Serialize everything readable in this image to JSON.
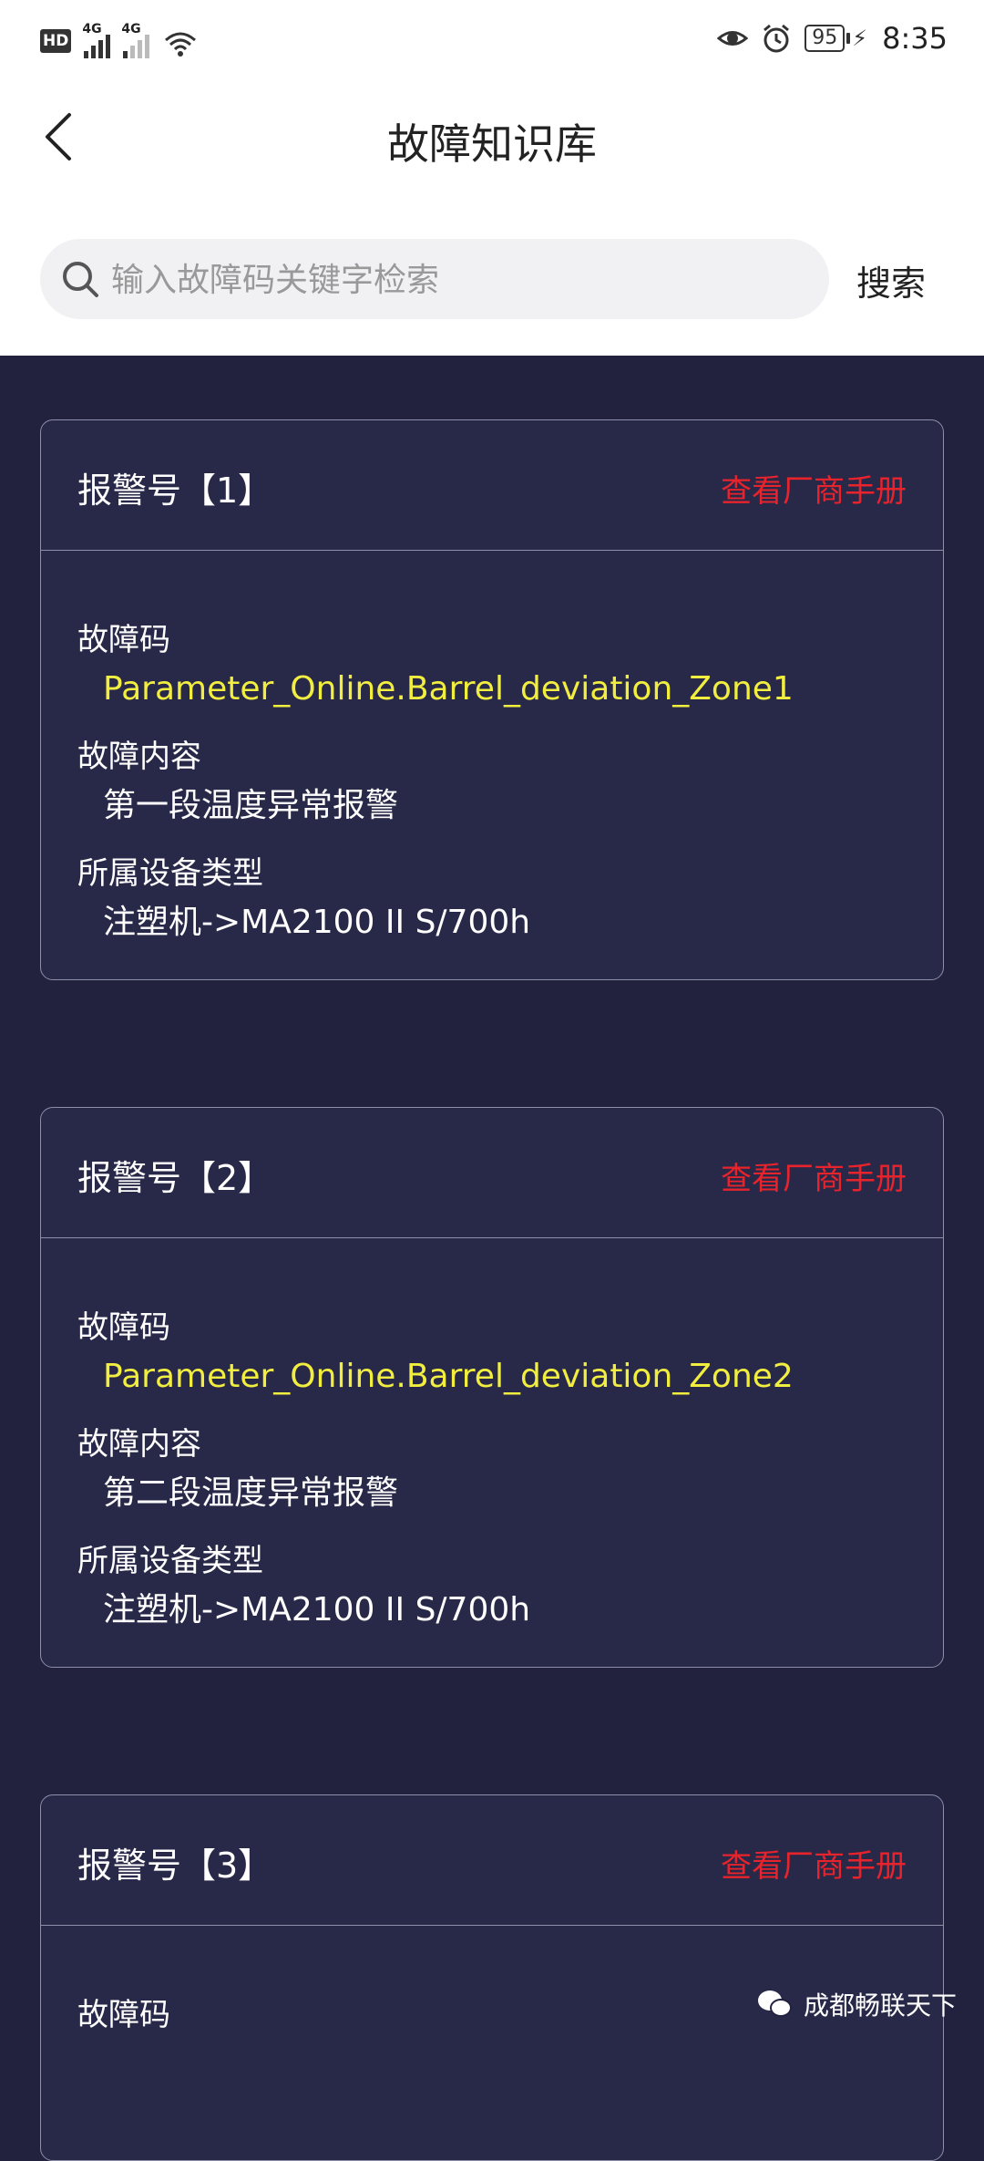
{
  "status_bar": {
    "hd": "HD",
    "signal1": "4G",
    "signal2": "4G",
    "battery": "95",
    "time": "8:35"
  },
  "header": {
    "title": "故障知识库",
    "back_icon": "chevron-left-icon"
  },
  "search": {
    "placeholder": "输入故障码关键字检索",
    "button": "搜索"
  },
  "labels": {
    "code": "故障码",
    "content": "故障内容",
    "device": "所属设备类型",
    "manual": "查看厂商手册"
  },
  "cards": [
    {
      "title": "报警号【1】",
      "code": "Parameter_Online.Barrel_deviation_Zone1",
      "content": "第一段温度异常报警",
      "device": "注塑机->MA2100 II S/700h"
    },
    {
      "title": "报警号【2】",
      "code": "Parameter_Online.Barrel_deviation_Zone2",
      "content": "第二段温度异常报警",
      "device": "注塑机->MA2100 II S/700h"
    },
    {
      "title": "报警号【3】",
      "code": "",
      "content": "",
      "device": ""
    }
  ],
  "watermark": "成都畅联天下",
  "colors": {
    "background": "#22223f",
    "code_text": "#f1ee3f",
    "manual_link": "#e8232b"
  }
}
